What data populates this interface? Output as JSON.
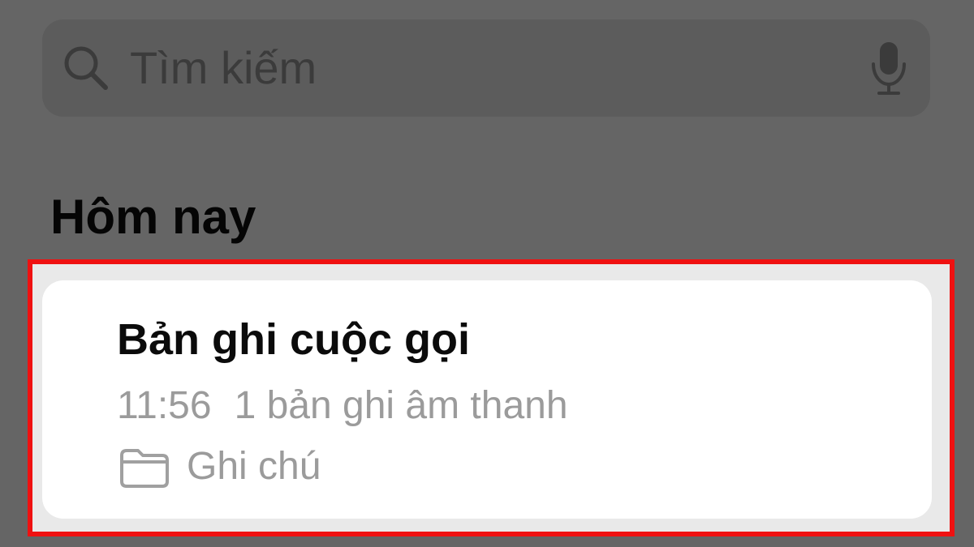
{
  "search": {
    "placeholder": "Tìm kiếm",
    "left_icon": "search-icon",
    "right_icon": "microphone-icon"
  },
  "section": {
    "title": "Hôm nay"
  },
  "note": {
    "title": "Bản ghi cuộc gọi",
    "time": "11:56",
    "summary": "1 bản ghi âm thanh",
    "folder_icon": "folder-icon",
    "folder": "Ghi chú"
  },
  "colors": {
    "background": "#656565",
    "search_background": "#5c5c5c",
    "highlight": "#ef1111",
    "card": "#ffffff",
    "secondary_text": "#9b9b9b"
  }
}
